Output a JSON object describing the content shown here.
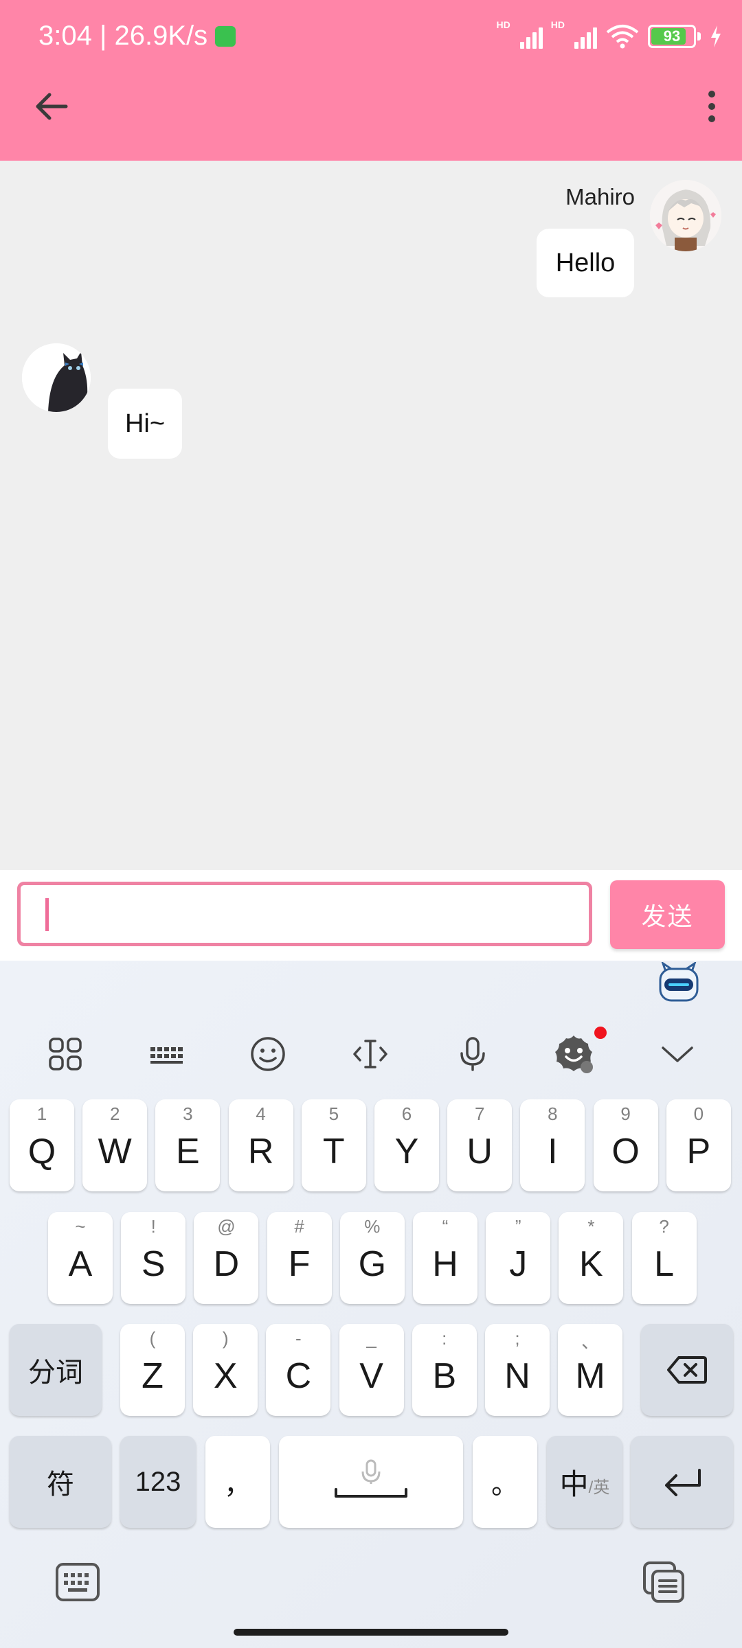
{
  "status_bar": {
    "time_speed": "3:04 | 26.9K/s",
    "signal_1_label": "HD",
    "signal_2_label": "HD",
    "battery": "93"
  },
  "chat": {
    "sender_name": "Mahiro",
    "messages": [
      {
        "from": "me",
        "text": "Hello"
      },
      {
        "from": "other",
        "text": "Hi~"
      }
    ]
  },
  "composer": {
    "input_value": "",
    "send_label": "发送"
  },
  "keyboard": {
    "toolbar": [
      "grid-icon",
      "keyboard-layout-icon",
      "emoji-icon",
      "cursor-icon",
      "microphone-icon",
      "ai-assistant-icon",
      "collapse-icon"
    ],
    "row1": [
      {
        "main": "Q",
        "sub": "1"
      },
      {
        "main": "W",
        "sub": "2"
      },
      {
        "main": "E",
        "sub": "3"
      },
      {
        "main": "R",
        "sub": "4"
      },
      {
        "main": "T",
        "sub": "5"
      },
      {
        "main": "Y",
        "sub": "6"
      },
      {
        "main": "U",
        "sub": "7"
      },
      {
        "main": "I",
        "sub": "8"
      },
      {
        "main": "O",
        "sub": "9"
      },
      {
        "main": "P",
        "sub": "0"
      }
    ],
    "row2": [
      {
        "main": "A",
        "sub": "~"
      },
      {
        "main": "S",
        "sub": "!"
      },
      {
        "main": "D",
        "sub": "@"
      },
      {
        "main": "F",
        "sub": "#"
      },
      {
        "main": "G",
        "sub": "%"
      },
      {
        "main": "H",
        "sub": "“"
      },
      {
        "main": "J",
        "sub": "”"
      },
      {
        "main": "K",
        "sub": "*"
      },
      {
        "main": "L",
        "sub": "?"
      }
    ],
    "row3": [
      {
        "main": "Z",
        "sub": "("
      },
      {
        "main": "X",
        "sub": ")"
      },
      {
        "main": "C",
        "sub": "-"
      },
      {
        "main": "V",
        "sub": "_"
      },
      {
        "main": "B",
        "sub": ":"
      },
      {
        "main": "N",
        "sub": ";"
      },
      {
        "main": "M",
        "sub": "、"
      }
    ],
    "segment_label": "分词",
    "symbols_label": "符",
    "numbers_label": "123",
    "comma_label": "，",
    "period_label": "。",
    "lang_main": "中",
    "lang_sub": "/英"
  },
  "colors": {
    "accent": "#ff85a8",
    "input_border": "#ef82a3"
  }
}
